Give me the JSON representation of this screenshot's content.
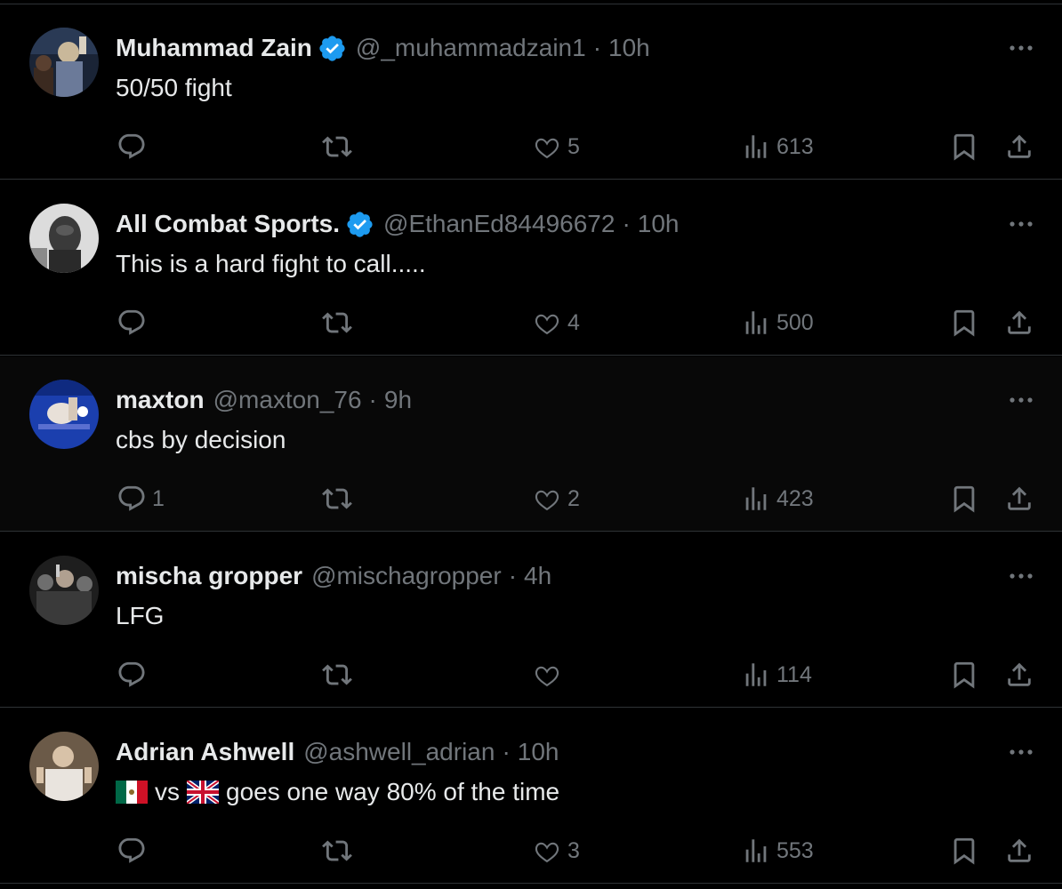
{
  "tweets": [
    {
      "name": "Muhammad Zain",
      "verified": true,
      "handle": "@_muhammadzain1",
      "separator": "·",
      "time": "10h",
      "text": "50/50 fight",
      "replies": "",
      "retweets": "",
      "likes": "5",
      "views": "613",
      "avatar_colors": [
        "#2a3a55",
        "#c9b89a",
        "#6b7a99"
      ]
    },
    {
      "name": "All Combat Sports.",
      "verified": true,
      "handle": "@EthanEd84496672",
      "separator": "·",
      "time": "10h",
      "text": "This is a hard fight to call.....",
      "replies": "",
      "retweets": "",
      "likes": "4",
      "views": "500",
      "avatar_colors": [
        "#d8d8d8",
        "#3a3a3a",
        "#8a8a8a"
      ]
    },
    {
      "name": "maxton",
      "verified": false,
      "handle": "@maxton_76",
      "separator": "·",
      "time": "9h",
      "text": "cbs by decision",
      "replies": "1",
      "retweets": "",
      "likes": "2",
      "views": "423",
      "avatar_colors": [
        "#1b3fae",
        "#e8e0d8",
        "#5a6fd0"
      ]
    },
    {
      "name": "mischa gropper",
      "verified": false,
      "handle": "@mischagropper",
      "separator": "·",
      "time": "4h",
      "text": "LFG",
      "replies": "",
      "retweets": "",
      "likes": "",
      "views": "114",
      "avatar_colors": [
        "#1e1e1e",
        "#6e6e6e",
        "#b0a090"
      ]
    },
    {
      "name": "Adrian Ashwell",
      "verified": false,
      "handle": "@ashwell_adrian",
      "separator": "·",
      "time": "10h",
      "text_parts": [
        "vs",
        "goes one way 80% of the time"
      ],
      "flags": [
        "mexico-flag",
        "uk-flag"
      ],
      "replies": "",
      "retweets": "",
      "likes": "3",
      "views": "553",
      "avatar_colors": [
        "#6b5a48",
        "#d8c2a8",
        "#e9e4de"
      ]
    }
  ],
  "colors": {
    "background": "#000000",
    "highlight_background": "#080808",
    "divider": "#2f3336",
    "primary_text": "#e7e9ea",
    "secondary_text": "#71767b",
    "verified_blue": "#1d9bf0"
  },
  "icons": {
    "more": "more-dots-icon",
    "reply": "reply-bubble-icon",
    "retweet": "retweet-arrows-icon",
    "like": "heart-icon",
    "views": "views-bars-icon",
    "bookmark": "bookmark-icon",
    "share": "share-upload-icon",
    "verified": "verified-badge-icon"
  }
}
